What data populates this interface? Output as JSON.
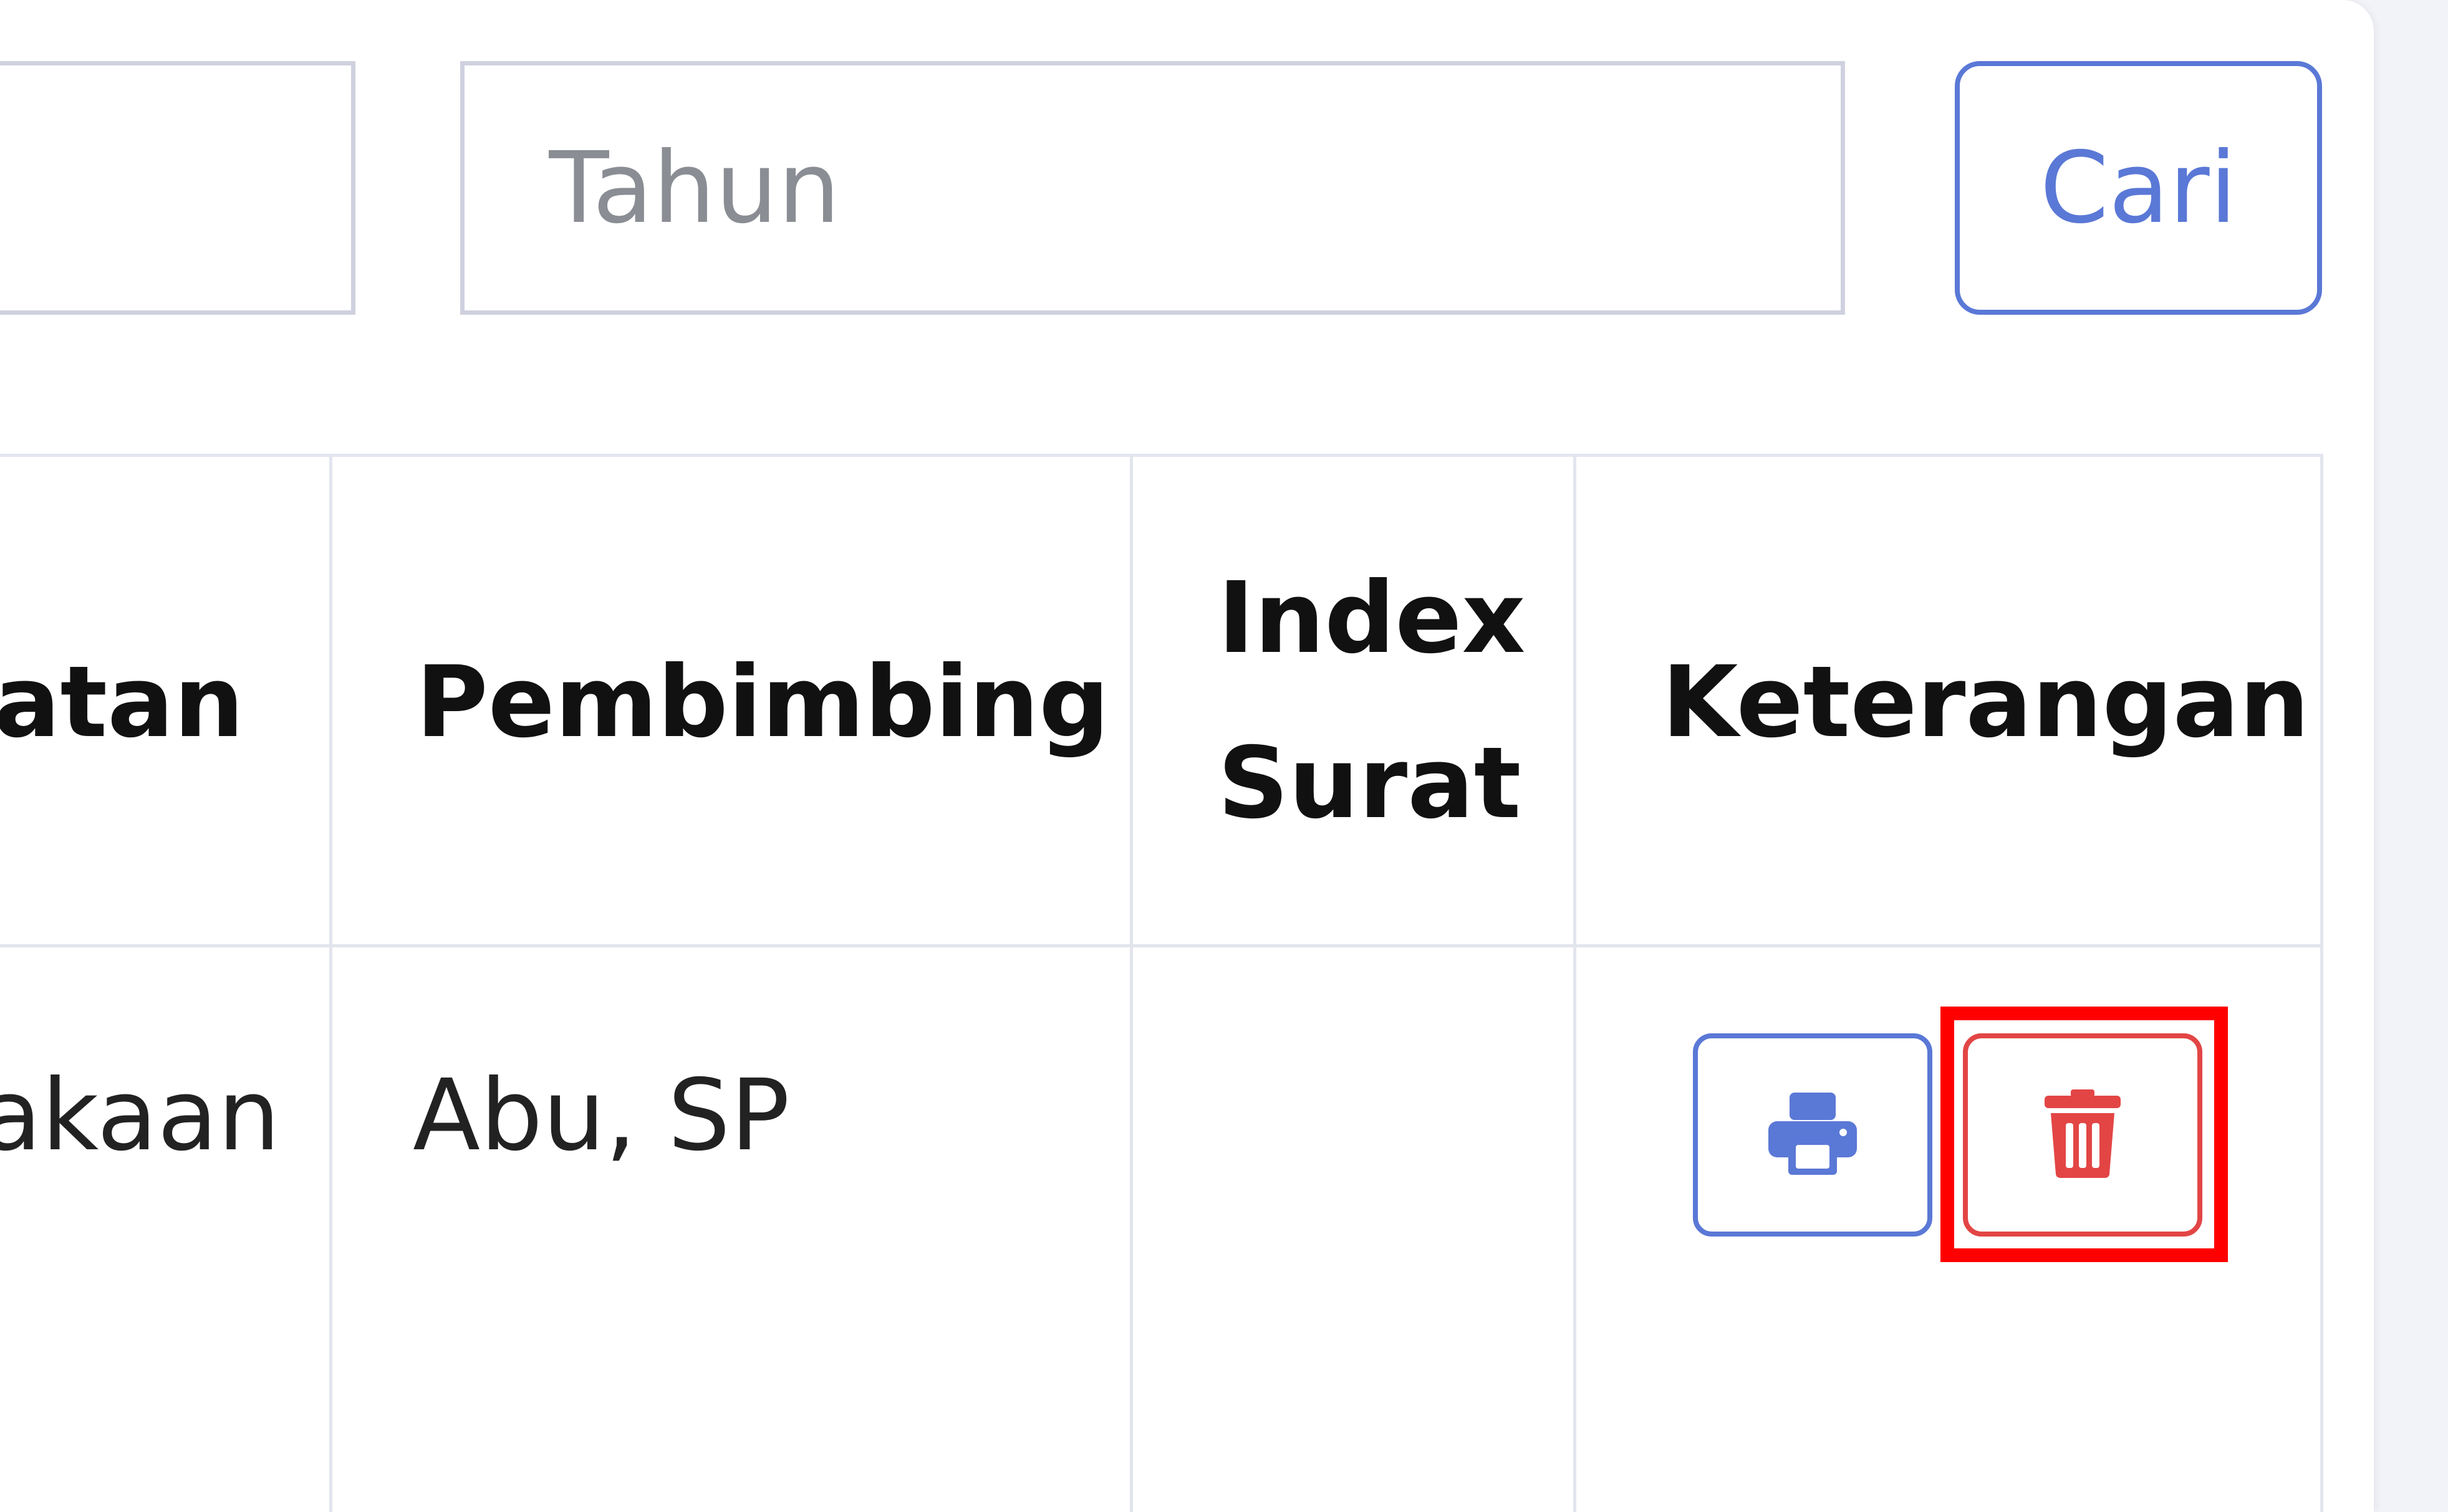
{
  "filters": {
    "left_input_value": "",
    "year_placeholder": "Tahun",
    "search_button_label": "Cari"
  },
  "table": {
    "headers": {
      "col_partial": "atan",
      "pembimbing": "Pembimbing",
      "index_surat_line1": "Index",
      "index_surat_line2": "Surat",
      "keterangan": "Keterangan"
    },
    "rows": [
      {
        "col_partial": "akaan",
        "pembimbing": "Abu, SP",
        "index_surat": ""
      }
    ]
  },
  "actions": {
    "print_icon": "printer-icon",
    "delete_icon": "trash-icon",
    "print_color": "#5a78d6",
    "delete_color": "#e34545",
    "highlight_color": "#ff0000"
  }
}
